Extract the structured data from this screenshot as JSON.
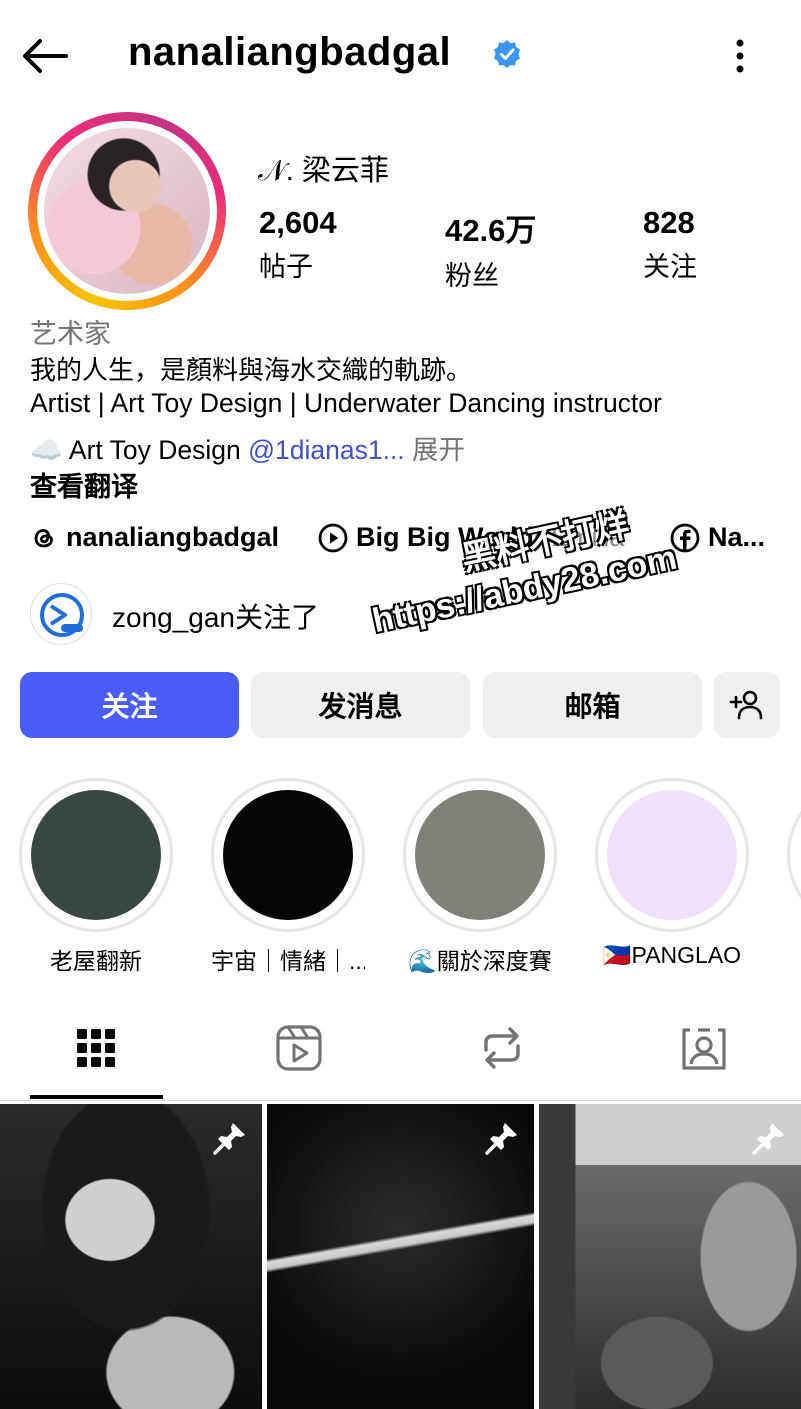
{
  "header": {
    "username": "nanaliangbadgal",
    "back_icon": "arrow-left-icon",
    "verified_icon": "verified-badge-icon",
    "more_icon": "more-vertical-icon"
  },
  "profile": {
    "display_name": "𝒩. 梁云菲",
    "stats": [
      {
        "value": "2,604",
        "label": "帖子"
      },
      {
        "value": "42.6万",
        "label": "粉丝"
      },
      {
        "value": "828",
        "label": "关注"
      }
    ],
    "category": "艺术家",
    "bio_line1": "我的人生，是顏料與海水交織的軌跡。",
    "bio_line2": "Artist | Art Toy Design  | Underwater Dancing instructor",
    "bio_line3_prefix": "☁️ Art Toy Design ",
    "bio_line3_mention": "@1dianas1...",
    "bio_line3_more": " 展开",
    "translate": "查看翻译"
  },
  "links": {
    "threads": "nanaliangbadgal",
    "music_title": "Big Big World",
    "music_artist": " • Emilia",
    "facebook": "Na..."
  },
  "followed_by": {
    "text": "zong_gan关注了"
  },
  "watermark": {
    "line1": "黑料不打烊",
    "line2": "https://abdy28.com"
  },
  "buttons": {
    "follow": "关注",
    "message": "发消息",
    "email": "邮箱",
    "add_user_icon": "add-person-icon"
  },
  "highlights": [
    {
      "label": "老屋翻新",
      "color": "#3b4744"
    },
    {
      "label": "宇宙｜情緒｜...",
      "color": "#050505"
    },
    {
      "label": "🌊關於深度賽",
      "color": "#7f8278"
    },
    {
      "label": "🇵🇭PANGLAO",
      "color": "#efe0fb"
    }
  ],
  "tabs": [
    "grid-icon",
    "reels-icon",
    "reposts-icon",
    "tagged-icon"
  ],
  "colors": {
    "accent": "#4a5df9",
    "verified": "#3897f0",
    "mention": "#4150c8",
    "button_bg": "#efeff1"
  }
}
